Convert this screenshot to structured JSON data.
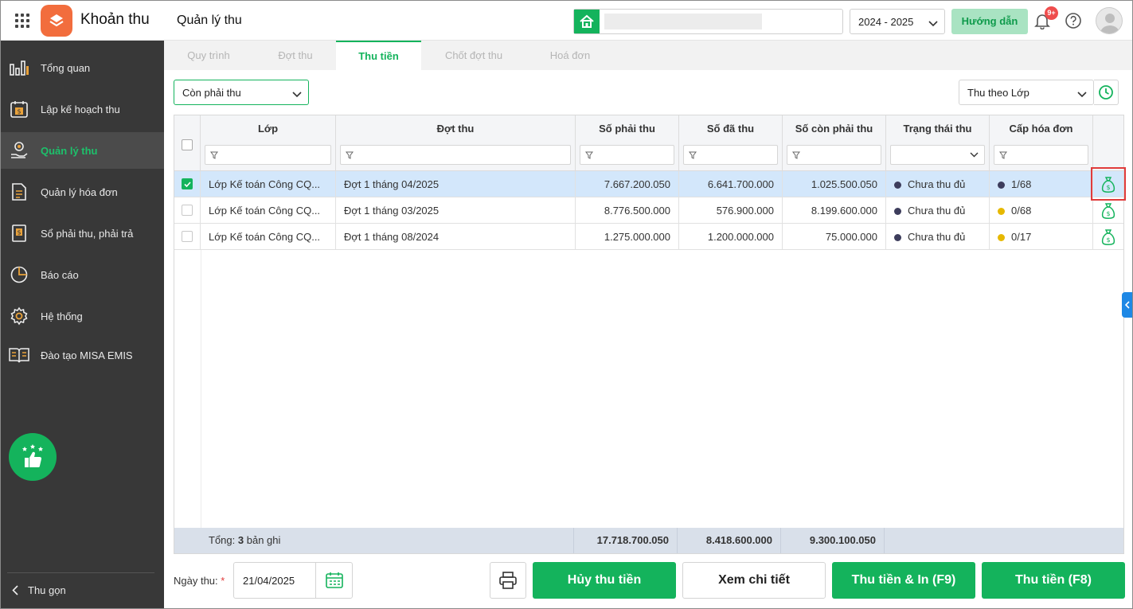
{
  "app": {
    "name": "Khoản thu",
    "page_title": "Quản lý thu"
  },
  "header": {
    "school_icon": "home-icon",
    "school_year": "2024 - 2025",
    "guide_label": "Hướng dẫn",
    "notification_count": "9+",
    "accent": "#14b35c"
  },
  "sidebar": {
    "items": [
      {
        "label": "Tổng quan",
        "icon": "bar-chart-icon"
      },
      {
        "label": "Lập kế hoạch thu",
        "icon": "calendar-dollar-icon"
      },
      {
        "label": "Quản lý thu",
        "icon": "hand-coin-icon"
      },
      {
        "label": "Quản lý hóa đơn",
        "icon": "invoice-icon"
      },
      {
        "label": "Sổ phải thu, phải trả",
        "icon": "ledger-icon"
      },
      {
        "label": "Báo cáo",
        "icon": "pie-chart-icon"
      },
      {
        "label": "Hệ thống",
        "icon": "gear-icon"
      },
      {
        "label": "Đào tạo MISA EMIS",
        "icon": "book-icon"
      }
    ],
    "active_index": 2,
    "collapse_label": "Thu gọn"
  },
  "tabs": [
    "Quy trình",
    "Đợt thu",
    "Thu tiền",
    "Chốt đợt thu",
    "Hoá đơn"
  ],
  "active_tab": 2,
  "filters": {
    "status": "Còn phải thu",
    "mode": "Thu theo Lớp"
  },
  "table": {
    "columns": [
      "Lớp",
      "Đợt thu",
      "Số phải thu",
      "Số đã thu",
      "Số còn phải thu",
      "Trạng thái thu",
      "Cấp hóa đơn"
    ],
    "rows": [
      {
        "selected": true,
        "class": "Lớp Kế toán Công CQ...",
        "period": "Đợt 1 tháng 04/2025",
        "due": "7.667.200.050",
        "paid": "6.641.700.000",
        "remaining": "1.025.500.050",
        "status": "Chưa thu đủ",
        "invoice": "1/68",
        "invoice_color": "#3d3d5c"
      },
      {
        "selected": false,
        "class": "Lớp Kế toán Công CQ...",
        "period": "Đợt 1 tháng 03/2025",
        "due": "8.776.500.000",
        "paid": "576.900.000",
        "remaining": "8.199.600.000",
        "status": "Chưa thu đủ",
        "invoice": "0/68",
        "invoice_color": "#e6b800"
      },
      {
        "selected": false,
        "class": "Lớp Kế toán Công CQ...",
        "period": "Đợt 1 tháng 08/2024",
        "due": "1.275.000.000",
        "paid": "1.200.000.000",
        "remaining": "75.000.000",
        "status": "Chưa thu đủ",
        "invoice": "0/17",
        "invoice_color": "#e6b800"
      }
    ],
    "totals": {
      "label_prefix": "Tổng:",
      "count": "3",
      "label_suffix": "bản ghi",
      "due": "17.718.700.050",
      "paid": "8.418.600.000",
      "remaining": "9.300.100.050"
    }
  },
  "footer": {
    "date_label": "Ngày thu:",
    "required_mark": "*",
    "date_value": "21/04/2025",
    "cancel_label": "Hủy thu tiền",
    "detail_label": "Xem chi tiết",
    "collect_print_label": "Thu tiền & In (F9)",
    "collect_label": "Thu tiền (F8)"
  }
}
